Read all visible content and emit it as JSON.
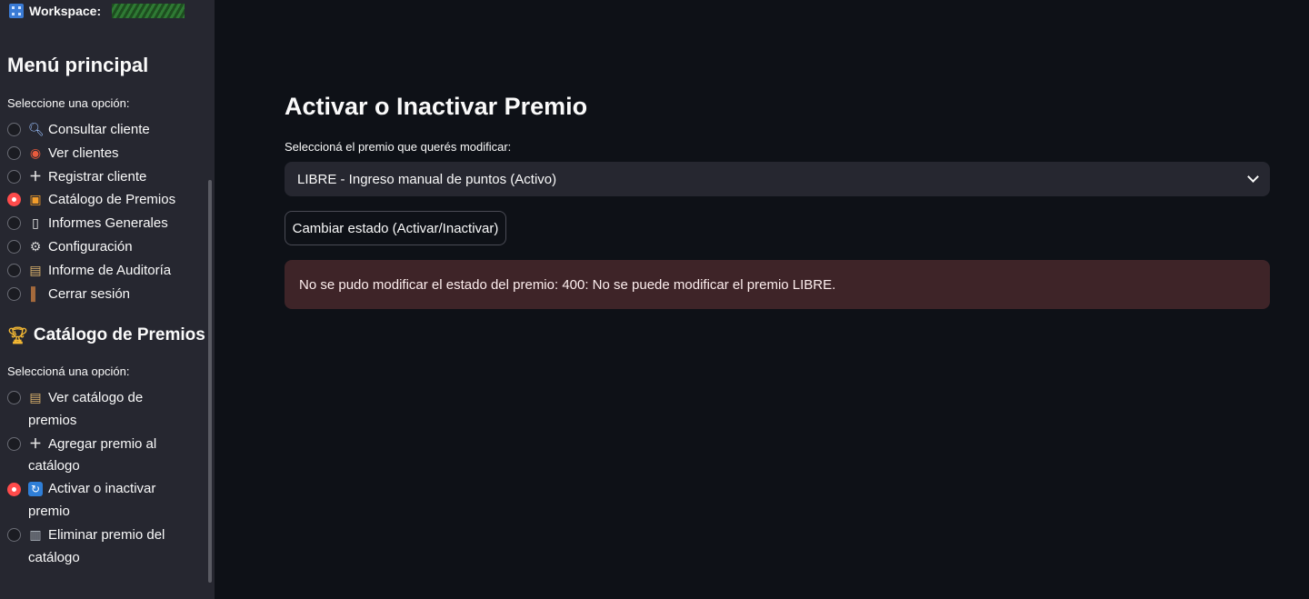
{
  "sidebar": {
    "workspace_label": "Workspace:",
    "menu_title": "Menú principal",
    "menu_caption": "Seleccione una opción:",
    "menu_items": [
      {
        "icon": "search-icon",
        "label": "Consultar cliente",
        "selected": false
      },
      {
        "icon": "eye-icon",
        "label": "Ver clientes",
        "selected": false
      },
      {
        "icon": "plus-icon",
        "label": "Registrar cliente",
        "selected": false
      },
      {
        "icon": "gift-icon",
        "label": "Catálogo de Premios",
        "selected": true
      },
      {
        "icon": "page-icon",
        "label": "Informes Generales",
        "selected": false
      },
      {
        "icon": "gear-icon",
        "label": "Configuración",
        "selected": false
      },
      {
        "icon": "clipboard-icon",
        "label": "Informe de Auditoría",
        "selected": false
      },
      {
        "icon": "door-icon",
        "label": "Cerrar sesión",
        "selected": false
      }
    ],
    "catalog_title": "Catálogo de Premios",
    "catalog_caption": "Seleccioná una opción:",
    "catalog_items": [
      {
        "icon": "clipboard-icon",
        "line1": "Ver catálogo de",
        "line2": "premios",
        "selected": false
      },
      {
        "icon": "plus-icon",
        "line1": "Agregar premio al",
        "line2": "catálogo",
        "selected": false
      },
      {
        "icon": "cycle-icon",
        "line1": "Activar o inactivar",
        "line2": "premio",
        "selected": true
      },
      {
        "icon": "trash-icon",
        "line1": "Eliminar premio del",
        "line2": "catálogo",
        "selected": false
      }
    ]
  },
  "main": {
    "title": "Activar o Inactivar Premio",
    "select_label": "Seleccioná el premio que querés modificar:",
    "select_value": "LIBRE - Ingreso manual de puntos (Activo)",
    "button_label": "Cambiar estado (Activar/Inactivar)",
    "error_message": "No se pudo modificar el estado del premio: 400: No se puede modificar el premio LIBRE."
  },
  "colors": {
    "background": "#0e1117",
    "sidebar": "#262730",
    "accent": "#ff4b4b",
    "error_bg": "#3e2428"
  }
}
